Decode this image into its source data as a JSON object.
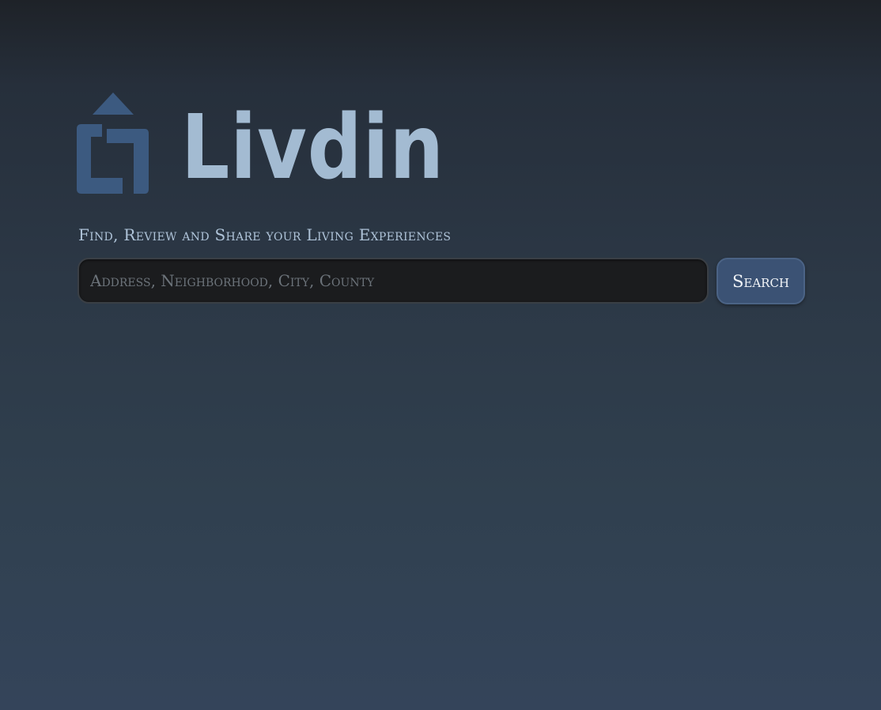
{
  "brand": {
    "name": "Livdin",
    "logo_icon": "house-arrow-icon",
    "logo_mark_color": "#3c5a80",
    "text_color": "#a3bbd2"
  },
  "tagline": "Find, Review and Share your Living Experiences",
  "search": {
    "value": "",
    "placeholder": "Address, Neighborhood, City, County",
    "button_label": "Search"
  },
  "colors": {
    "button_bg": "#3b5274",
    "input_bg": "#1b1c1e",
    "tagline": "#aec3d8"
  }
}
